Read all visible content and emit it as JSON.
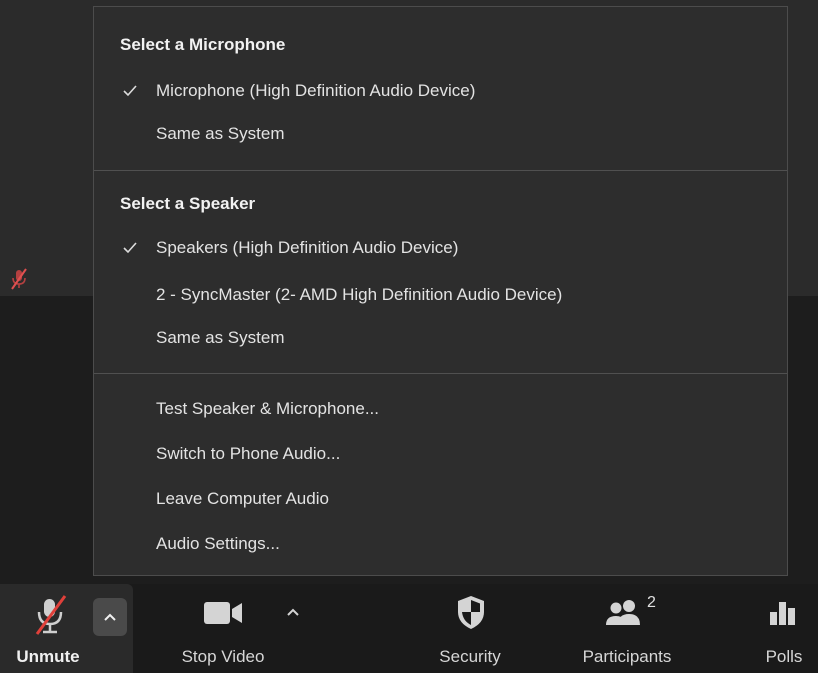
{
  "audio_menu": {
    "microphone_section": {
      "title": "Select a Microphone",
      "items": [
        {
          "label": "Microphone (High Definition Audio Device)",
          "checked": true
        },
        {
          "label": "Same as System",
          "checked": false
        }
      ]
    },
    "speaker_section": {
      "title": "Select a Speaker",
      "items": [
        {
          "label": "Speakers (High Definition Audio Device)",
          "checked": true
        },
        {
          "label": "2 - SyncMaster (2- AMD High Definition Audio Device)",
          "checked": false
        },
        {
          "label": "Same as System",
          "checked": false
        }
      ]
    },
    "actions": [
      {
        "label": "Test Speaker & Microphone..."
      },
      {
        "label": "Switch to Phone Audio..."
      },
      {
        "label": "Leave Computer Audio"
      },
      {
        "label": "Audio Settings..."
      }
    ]
  },
  "toolbar": {
    "unmute_label": "Unmute",
    "stop_video_label": "Stop Video",
    "security_label": "Security",
    "participants_label": "Participants",
    "participants_count": "2",
    "polls_label": "Polls"
  },
  "colors": {
    "mute_slash": "#e0403a",
    "menu_bg": "#2d2d2d",
    "toolbar_bg": "#1a1a1a"
  },
  "icons": [
    "muted-microphone-icon",
    "chevron-up-icon",
    "video-camera-icon",
    "shield-icon",
    "participants-icon",
    "polls-icon",
    "checkmark-icon"
  ]
}
